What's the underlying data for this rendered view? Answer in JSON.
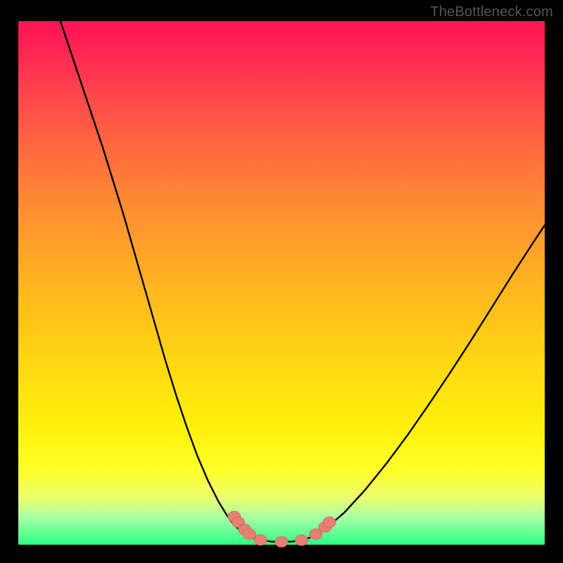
{
  "watermark": {
    "text": "TheBottleneck.com"
  },
  "chart_data": {
    "type": "line",
    "title": "",
    "xlabel": "",
    "ylabel": "",
    "xlim": [
      0,
      100
    ],
    "ylim": [
      0,
      100
    ],
    "grid": false,
    "series": [
      {
        "name": "left-branch",
        "x": [
          8,
          10,
          12,
          14,
          16,
          18,
          20,
          22,
          24,
          26,
          28,
          30,
          32,
          34,
          36,
          38,
          40,
          41.5,
          43,
          44.3
        ],
        "y": [
          100,
          94,
          88,
          82,
          76,
          69.5,
          63,
          56,
          49,
          42,
          35,
          28.5,
          22.5,
          17,
          12.3,
          8.3,
          5,
          3.3,
          2.1,
          1.4
        ]
      },
      {
        "name": "trough",
        "x": [
          44.3,
          46,
          48,
          50,
          52,
          54,
          55.5
        ],
        "y": [
          1.4,
          0.9,
          0.6,
          0.55,
          0.6,
          0.9,
          1.4
        ]
      },
      {
        "name": "right-branch",
        "x": [
          55.5,
          57,
          59,
          62,
          66,
          70,
          74,
          78,
          82,
          86,
          90,
          94,
          98,
          100
        ],
        "y": [
          1.4,
          2.2,
          3.6,
          6.2,
          10.6,
          15.6,
          21,
          26.8,
          32.8,
          39,
          45.4,
          51.8,
          58,
          61
        ]
      }
    ],
    "markers": [
      {
        "name": "left-cluster-upper-top",
        "x": 41.0,
        "y": 5.4
      },
      {
        "name": "left-cluster-upper-bottom",
        "x": 41.8,
        "y": 4.3
      },
      {
        "name": "left-cluster-lower-top",
        "x": 43.0,
        "y": 2.9
      },
      {
        "name": "left-cluster-lower-bottom",
        "x": 43.9,
        "y": 2.0
      },
      {
        "name": "trough-left",
        "x": 46.0,
        "y": 0.9
      },
      {
        "name": "trough-mid",
        "x": 50.0,
        "y": 0.55
      },
      {
        "name": "trough-right",
        "x": 53.8,
        "y": 0.85
      },
      {
        "name": "right-cluster-lower",
        "x": 56.5,
        "y": 2.0
      },
      {
        "name": "right-cluster-upper-bottom",
        "x": 58.3,
        "y": 3.4
      },
      {
        "name": "right-cluster-upper-top",
        "x": 59.1,
        "y": 4.3
      }
    ],
    "colors": {
      "curve": "#000000",
      "marker_fill": "#e58074",
      "marker_stroke": "#d86a5e"
    }
  }
}
